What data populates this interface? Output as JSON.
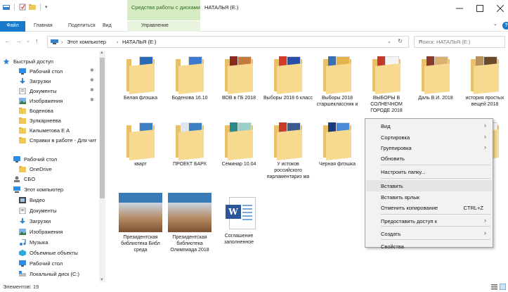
{
  "window": {
    "title": "НАТАЛЬЯ (E:)",
    "context_tab_header": "Средства работы с дисками"
  },
  "ribbon": {
    "tabs": [
      "Файл",
      "Главная",
      "Поделиться",
      "Вид",
      "Управление"
    ]
  },
  "address": {
    "crumbs": [
      "Этот компьютер",
      "НАТАЛЬЯ (E:)"
    ],
    "search_placeholder": "Поиск: НАТАЛЬЯ (E:)"
  },
  "nav": {
    "items": [
      {
        "label": "Быстрый доступ",
        "icon": "star-icon",
        "pinned": false
      },
      {
        "label": "Рабочий стол",
        "icon": "desktop-icon",
        "pinned": true
      },
      {
        "label": "Загрузки",
        "icon": "download-icon",
        "pinned": true
      },
      {
        "label": "Документы",
        "icon": "documents-icon",
        "pinned": true
      },
      {
        "label": "Изображения",
        "icon": "pictures-icon",
        "pinned": true
      },
      {
        "label": "Боденова",
        "icon": "folder-icon",
        "pinned": false
      },
      {
        "label": "Зулкарнеева",
        "icon": "folder-icon",
        "pinned": false
      },
      {
        "label": "Килыметова Е А",
        "icon": "folder-icon",
        "pinned": false
      },
      {
        "label": "Справки в работе - Для чит",
        "icon": "folder-icon",
        "pinned": false
      },
      {
        "label": "Рабочий стол",
        "icon": "desktop-icon",
        "pinned": false
      },
      {
        "label": "OneDrive",
        "icon": "folder-icon",
        "pinned": false
      },
      {
        "label": "СБО",
        "icon": "user-icon",
        "pinned": false
      },
      {
        "label": "Этот компьютер",
        "icon": "computer-icon",
        "pinned": false
      },
      {
        "label": "Видео",
        "icon": "video-icon",
        "pinned": false
      },
      {
        "label": "Документы",
        "icon": "documents-icon",
        "pinned": false
      },
      {
        "label": "Загрузки",
        "icon": "download-icon",
        "pinned": false
      },
      {
        "label": "Изображения",
        "icon": "pictures-icon",
        "pinned": false
      },
      {
        "label": "Музыка",
        "icon": "music-icon",
        "pinned": false
      },
      {
        "label": "Объемные объекты",
        "icon": "3d-objects-icon",
        "pinned": false
      },
      {
        "label": "Рабочий стол",
        "icon": "desktop-icon",
        "pinned": false
      },
      {
        "label": "Локальный диск (C:)",
        "icon": "drive-icon",
        "pinned": false
      }
    ]
  },
  "files": [
    {
      "label": "Белая флэшка",
      "kind": "folder"
    },
    {
      "label": "Боденова 16.10",
      "kind": "folder"
    },
    {
      "label": "ВОВ в ГБ 2018",
      "kind": "folder"
    },
    {
      "label": "Выборы 2018 6 класс",
      "kind": "folder"
    },
    {
      "label": "Выборы 2018 старшеклассник и",
      "kind": "folder"
    },
    {
      "label": "ВЫБОРЫ В СОЛНЕЧНОМ ГОРОДЕ 2018",
      "kind": "folder"
    },
    {
      "label": "Даль В.И. 2018",
      "kind": "folder"
    },
    {
      "label": "история простых вещей 2018",
      "kind": "folder"
    },
    {
      "label": "кварт",
      "kind": "folder"
    },
    {
      "label": "ПРОЕКТ БАРК",
      "kind": "folder"
    },
    {
      "label": "Семинар 10.04",
      "kind": "folder"
    },
    {
      "label": "У истоков российского парламентариз ма",
      "kind": "folder"
    },
    {
      "label": "Черная флэшка",
      "kind": "folder"
    },
    {
      "label": "",
      "kind": "folder"
    },
    {
      "label": "Президентская библиотека Библ среда",
      "kind": "image"
    },
    {
      "label": "Президентская библиотека Олимпиада 2018",
      "kind": "image"
    },
    {
      "label": "Соглашение заполненное",
      "kind": "word"
    }
  ],
  "context_menu": {
    "items": [
      {
        "label": "Вид",
        "submenu": true,
        "shortcut": ""
      },
      {
        "label": "Сортировка",
        "submenu": true,
        "shortcut": ""
      },
      {
        "label": "Группировка",
        "submenu": true,
        "shortcut": ""
      },
      {
        "label": "Обновить",
        "submenu": false,
        "shortcut": ""
      },
      {
        "label": "Настроить папку...",
        "submenu": false,
        "shortcut": ""
      },
      {
        "label": "Вставить",
        "submenu": false,
        "shortcut": ""
      },
      {
        "label": "Вставить ярлык",
        "submenu": false,
        "shortcut": ""
      },
      {
        "label": "Отменить копирование",
        "submenu": false,
        "shortcut": "CTRL+Z"
      },
      {
        "label": "Предоставить доступ к",
        "submenu": true,
        "shortcut": ""
      },
      {
        "label": "Создать",
        "submenu": true,
        "shortcut": ""
      },
      {
        "label": "Свойства",
        "submenu": false,
        "shortcut": ""
      }
    ],
    "highlighted": "Вставить"
  },
  "status": {
    "text": "Элементов: 19"
  },
  "colors": {
    "accent": "#1979ca",
    "context_tab": "#d6edc3",
    "folder": "#f7d98f"
  }
}
